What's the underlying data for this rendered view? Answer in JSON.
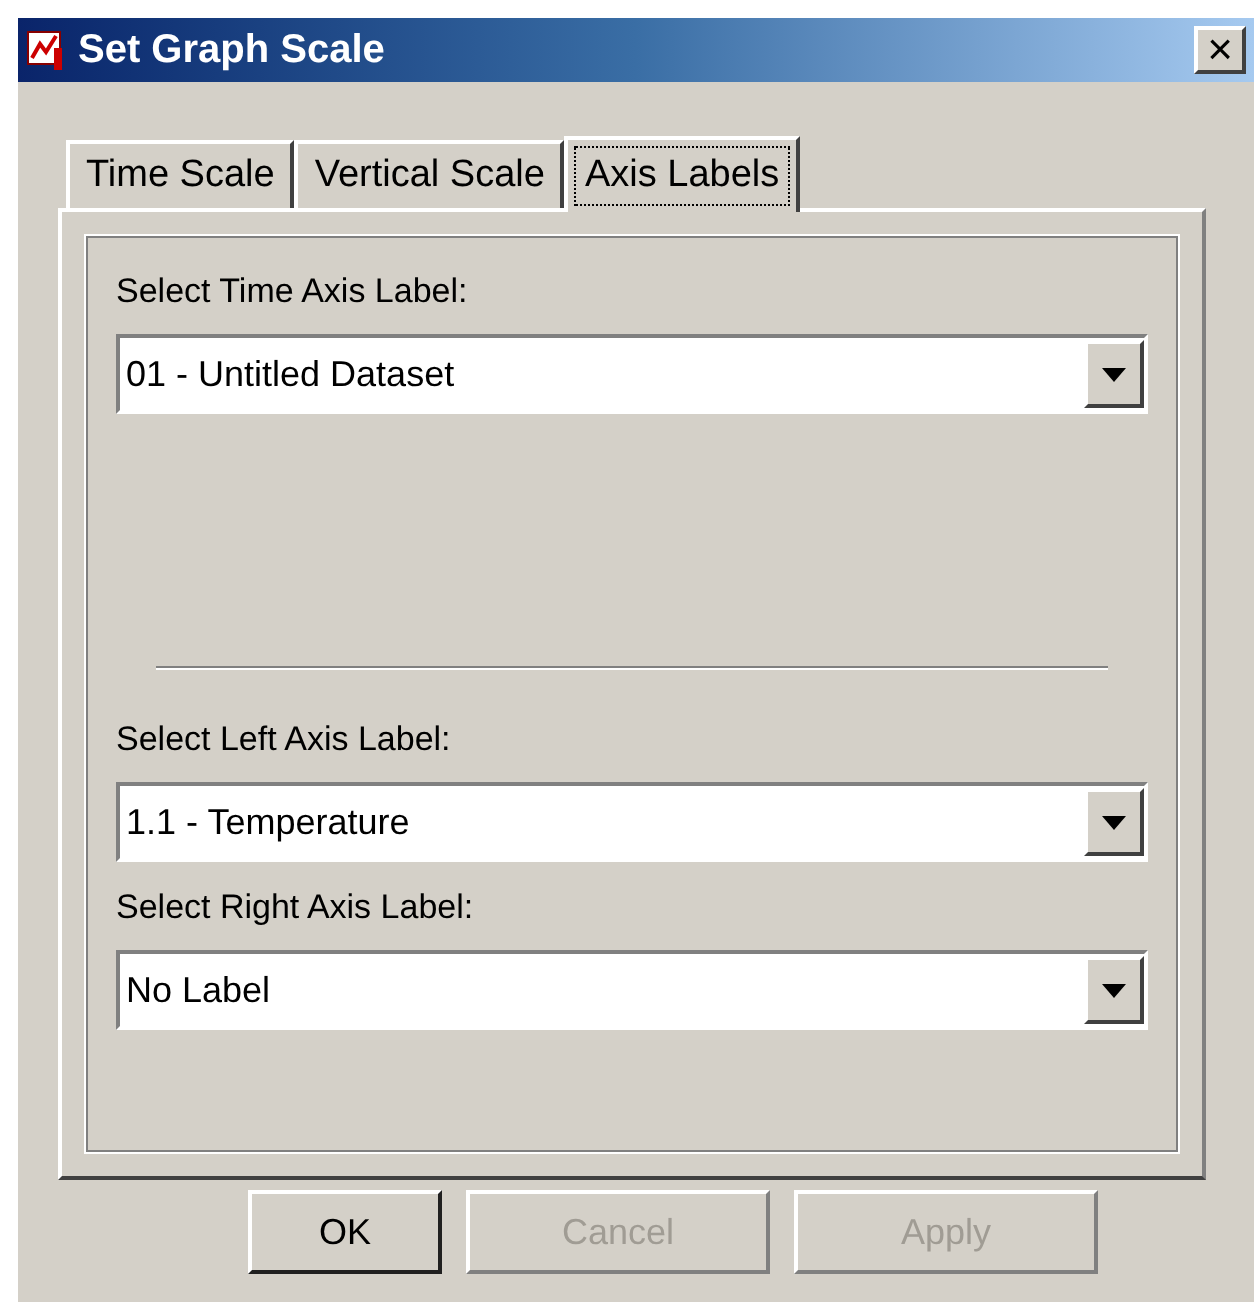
{
  "window": {
    "title": "Set Graph Scale",
    "close": "×"
  },
  "tabs": [
    {
      "label": "Time Scale",
      "selected": false
    },
    {
      "label": "Vertical Scale",
      "selected": false
    },
    {
      "label": "Axis Labels",
      "selected": true
    }
  ],
  "groups": [
    [
      {
        "label": "Select Time Axis Label:",
        "value": "01 - Untitled Dataset"
      }
    ],
    [
      {
        "label": "Select Left Axis Label:",
        "value": "1.1 - Temperature"
      },
      {
        "label": "Select Right Axis Label:",
        "value": "No Label"
      }
    ]
  ],
  "buttons": [
    {
      "label": "OK",
      "disabled": false
    },
    {
      "label": "Cancel",
      "disabled": true
    },
    {
      "label": "Apply",
      "disabled": true
    }
  ]
}
